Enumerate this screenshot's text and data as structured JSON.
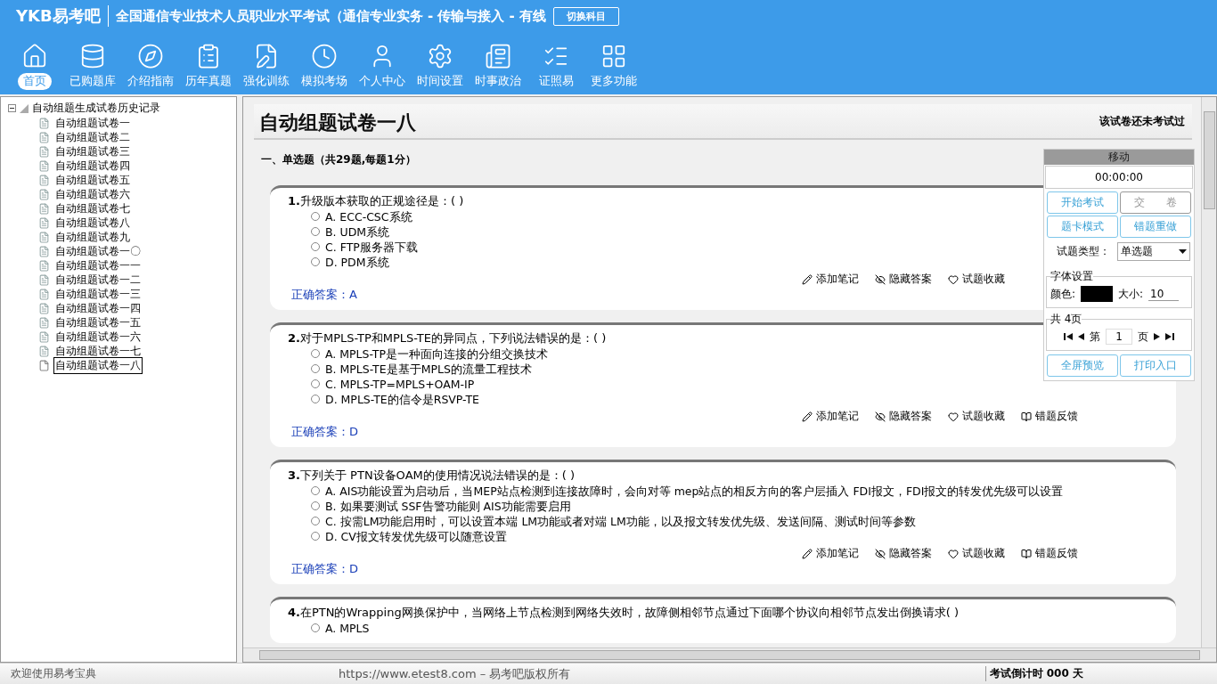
{
  "header": {
    "logo": "YKB易考吧",
    "title": "全国通信专业技术人员职业水平考试（通信专业实务 - 传输与接入 - 有线",
    "switch_button": "切换科目"
  },
  "toolbar": [
    {
      "label": "首页",
      "selected": true
    },
    {
      "label": "已购题库",
      "selected": false
    },
    {
      "label": "介绍指南",
      "selected": false
    },
    {
      "label": "历年真题",
      "selected": false
    },
    {
      "label": "强化训练",
      "selected": false
    },
    {
      "label": "模拟考场",
      "selected": false
    },
    {
      "label": "个人中心",
      "selected": false
    },
    {
      "label": "时间设置",
      "selected": false
    },
    {
      "label": "时事政治",
      "selected": false
    },
    {
      "label": "证照易",
      "selected": false
    },
    {
      "label": "更多功能",
      "selected": false
    }
  ],
  "tree": {
    "label": "自动组题生成试卷历史记录",
    "expanded": true,
    "children": [
      {
        "label": "自动组题试卷一",
        "selected": false
      },
      {
        "label": "自动组题试卷二",
        "selected": false
      },
      {
        "label": "自动组题试卷三",
        "selected": false
      },
      {
        "label": "自动组题试卷四",
        "selected": false
      },
      {
        "label": "自动组题试卷五",
        "selected": false
      },
      {
        "label": "自动组题试卷六",
        "selected": false
      },
      {
        "label": "自动组题试卷七",
        "selected": false
      },
      {
        "label": "自动组题试卷八",
        "selected": false
      },
      {
        "label": "自动组题试卷九",
        "selected": false
      },
      {
        "label": "自动组题试卷一〇",
        "selected": false
      },
      {
        "label": "自动组题试卷一一",
        "selected": false
      },
      {
        "label": "自动组题试卷一二",
        "selected": false
      },
      {
        "label": "自动组题试卷一三",
        "selected": false
      },
      {
        "label": "自动组题试卷一四",
        "selected": false
      },
      {
        "label": "自动组题试卷一五",
        "selected": false
      },
      {
        "label": "自动组题试卷一六",
        "selected": false
      },
      {
        "label": "自动组题试卷一七",
        "selected": false
      },
      {
        "label": "自动组题试卷一八",
        "selected": true
      }
    ]
  },
  "paper": {
    "title": "自动组题试卷一八",
    "status": "该试卷还未考试过",
    "section": "一、单选题（共29题,每题1分）",
    "questions": [
      {
        "number": "1.",
        "text": "升级版本获取的正规途径是：( )",
        "options": [
          {
            "text": "A. ECC-CSC系统",
            "selected": false
          },
          {
            "text": "B. UDM系统",
            "selected": false
          },
          {
            "text": "C. FTP服务器下载",
            "selected": false
          },
          {
            "text": "D. PDM系统",
            "selected": false
          }
        ],
        "actions": [
          "添加笔记",
          "隐藏答案",
          "试题收藏"
        ],
        "answer_label": "正确答案：",
        "answer": "A"
      },
      {
        "number": "2.",
        "text": "对于MPLS-TP和MPLS-TE的异同点，下列说法错误的是：( )",
        "options": [
          {
            "text": "A. MPLS-TP是一种面向连接的分组交换技术",
            "selected": false
          },
          {
            "text": "B. MPLS-TE是基于MPLS的流量工程技术",
            "selected": false
          },
          {
            "text": "C. MPLS-TP=MPLS+OAM-IP",
            "selected": false
          },
          {
            "text": "D. MPLS-TE的信令是RSVP-TE",
            "selected": false
          }
        ],
        "actions": [
          "添加笔记",
          "隐藏答案",
          "试题收藏",
          "错题反馈"
        ],
        "answer_label": "正确答案：",
        "answer": "D"
      },
      {
        "number": "3.",
        "text": "下列关于 PTN设备OAM的使用情况说法错误的是：( )",
        "options": [
          {
            "text": "A. AIS功能设置为启动后，当MEP站点检测到连接故障时，会向对等 mep站点的相反方向的客户层插入 FDI报文，FDI报文的转发优先级可以设置",
            "selected": false
          },
          {
            "text": "B. 如果要测试 SSF告警功能则 AIS功能需要启用",
            "selected": false
          },
          {
            "text": "C. 按需LM功能启用时，可以设置本端 LM功能或者对端 LM功能，以及报文转发优先级、发送间隔、测试时间等参数",
            "selected": false
          },
          {
            "text": "D. CV报文转发优先级可以随意设置",
            "selected": false
          }
        ],
        "actions": [
          "添加笔记",
          "隐藏答案",
          "试题收藏",
          "错题反馈"
        ],
        "answer_label": "正确答案：",
        "answer": "D"
      },
      {
        "number": "4.",
        "text": "在PTN的Wrapping网换保护中，当网络上节点检测到网络失效时，故障侧相邻节点通过下面哪个协议向相邻节点发出倒换请求( )",
        "options": [
          {
            "text": "A. MPLS",
            "selected": false
          }
        ]
      }
    ]
  },
  "panel": {
    "title": "移动",
    "timer": "00:00:00",
    "buttons": [
      "开始考试",
      "交　　卷",
      "题卡模式",
      "错题重做"
    ],
    "type_label": "试题类型：",
    "type_value": "单选题",
    "font_group": "字体设置",
    "color_label": "颜色:",
    "size_label": "大小:",
    "size_value": "10",
    "pages_group": "共 4页",
    "page_prefix": "第",
    "page_value": "1",
    "page_suffix": "页",
    "bottom_buttons": [
      "全屏预览",
      "打印入口"
    ]
  },
  "status_bar": {
    "welcome": "欢迎使用易考宝典",
    "copyright": "https://www.etest8.com – 易考吧版权所有",
    "countdown": "考试倒计时 000 天"
  }
}
